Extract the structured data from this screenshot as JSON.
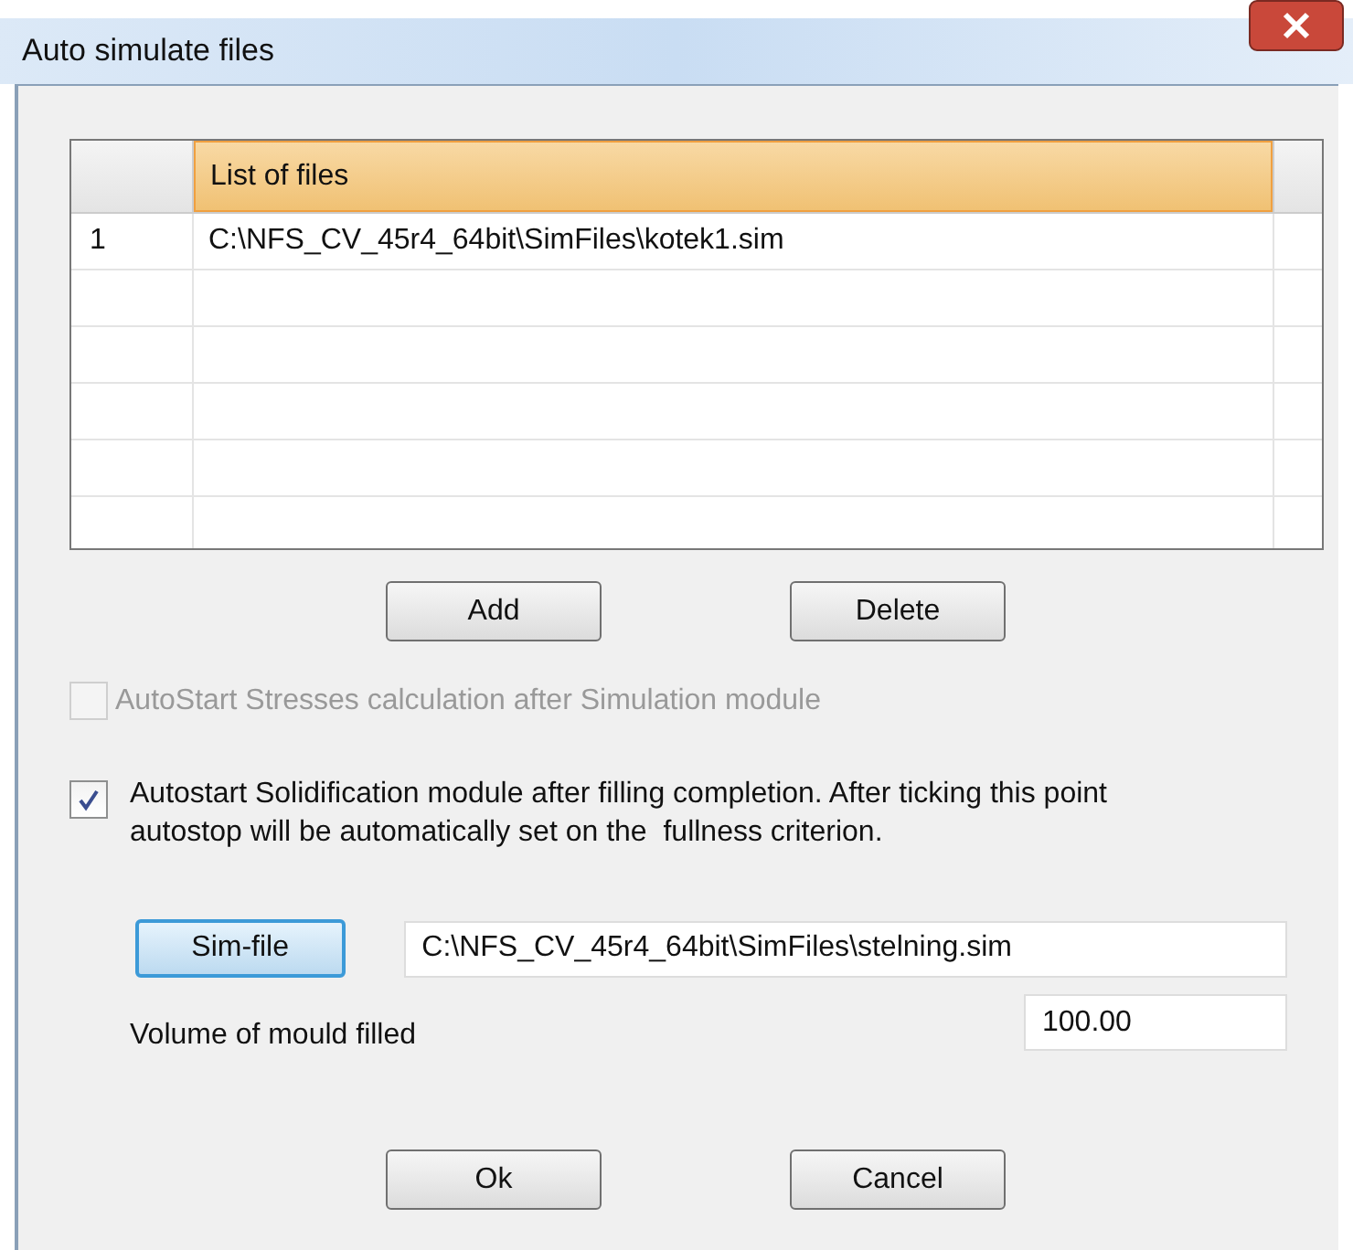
{
  "window": {
    "title": "Auto simulate files"
  },
  "table": {
    "columns": [
      "List of files"
    ],
    "rows": [
      {
        "number": "1",
        "path": "C:\\NFS_CV_45r4_64bit\\SimFiles\\kotek1.sim"
      }
    ]
  },
  "list_buttons": [
    {
      "label": "Add",
      "focused": false
    },
    {
      "label": "Delete",
      "focused": false
    }
  ],
  "options": [
    {
      "label": "AutoStart Stresses calculation after Simulation module",
      "checked": false,
      "disabled": true
    },
    {
      "label": "Autostart Solidification module after filling completion. After ticking this point autostop will be automatically set on the  fullness criterion.",
      "checked": true,
      "disabled": false
    }
  ],
  "sim_file": {
    "button": {
      "label": "Sim-file",
      "focused": true
    },
    "value": "C:\\NFS_CV_45r4_64bit\\SimFiles\\stelning.sim"
  },
  "volume": {
    "label": "Volume of mould filled",
    "value": "100.00"
  },
  "dialog_buttons": [
    {
      "label": "Ok",
      "focused": false
    },
    {
      "label": "Cancel",
      "focused": false
    }
  ]
}
